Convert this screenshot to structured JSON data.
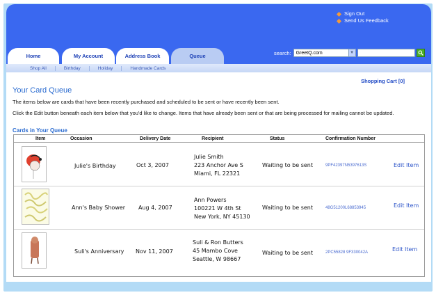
{
  "header": {
    "links": [
      "Sign Out",
      "Send Us Feedback"
    ],
    "tabs": [
      "Home",
      "My Account",
      "Address Book",
      "Queue"
    ],
    "search_label": "search:",
    "search_select": "GreetQ.com",
    "search_value": ""
  },
  "subnav": [
    "Shop All",
    "Birthday",
    "Holiday",
    "Handmade Cards"
  ],
  "cart_label": "Shopping Cart [0]",
  "page": {
    "title": "Your Card Queue",
    "intro": "The items below are cards that have been recently purchased and scheduled to be sent or have recently been sent.",
    "instructions": "Click the Edit button beneath each item below that you'd like to change. Items that have already been sent or that are being processed for mailing cannot be updated.",
    "queue_heading": "Cards in Your Queue"
  },
  "table": {
    "columns": [
      "Item",
      "Occasion",
      "Delivery Date",
      "Recipient",
      "Status",
      "Confirmation Number"
    ],
    "rows": [
      {
        "occasion": "Julie's Birthday",
        "date": "Oct 3, 2007",
        "recipient": [
          "Julie Smith",
          "223 Anchor Ave S",
          "Miami, FL 22321"
        ],
        "status": "Waiting to be sent",
        "confirmation": "9PF42397N5397613S",
        "edit": "Edit Item"
      },
      {
        "occasion": "Ann's Baby Shower",
        "date": "Aug 4, 2007",
        "recipient": [
          "Ann Powers",
          "100221 W 4th St",
          "New York, NY 45130"
        ],
        "status": "Waiting to be sent",
        "confirmation": "48G51200L68853945",
        "edit": "Edit Item"
      },
      {
        "occasion": "Suli's Anniversary",
        "date": "Nov 11, 2007",
        "recipient": [
          "Suli & Ron Butters",
          "45 Mambo Cove",
          "Seattle, W 98667"
        ],
        "status": "Waiting to be sent",
        "confirmation": "2PC55828 9F330042A",
        "edit": "Edit Item"
      }
    ]
  }
}
